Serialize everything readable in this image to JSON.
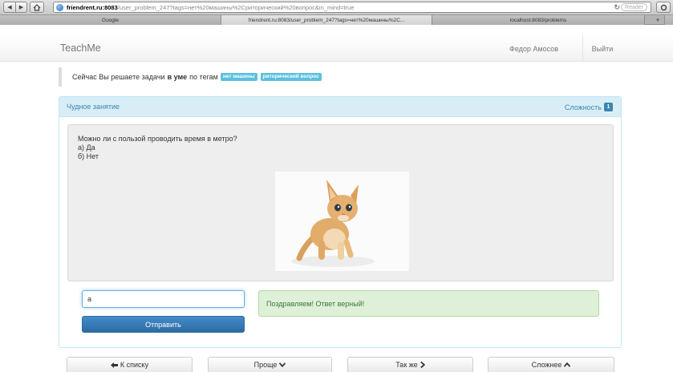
{
  "browser": {
    "url_host": "friendrent.ru:8083",
    "url_path": "/user_problem_247?tags=нет%20машины%2Cриторический%20вопрос&in_mind=true",
    "reader_label": "Reader",
    "tabs": [
      {
        "label": "Google",
        "active": false
      },
      {
        "label": "friendrent.ru:8083/user_problem_247?tags=нет%20машины%2C...",
        "active": true
      },
      {
        "label": "localhost:8083/problems",
        "active": false
      }
    ]
  },
  "navbar": {
    "brand": "TeachMe",
    "user_name": "Федор Амосов",
    "logout_label": "Выйти"
  },
  "info": {
    "prefix": "Сейчас Вы решаете задачи",
    "mode": "в уме",
    "tags_label": "по тегам",
    "tags": [
      "нет машины",
      "риторический вопрос"
    ]
  },
  "panel": {
    "title": "Чудное занятие",
    "difficulty_label": "Сложность",
    "difficulty_value": "1"
  },
  "question": {
    "text": "Можно ли с пользой проводить время в метро?",
    "options": [
      "а) Да",
      "б) Нет"
    ],
    "image_icon": "kitten-photo"
  },
  "answer": {
    "value": "a",
    "submit_label": "Отправить",
    "result_message": "Поздравляем! Ответ верный!"
  },
  "bottom_nav": {
    "back": "К списку",
    "easier": "Проще",
    "same": "Так же",
    "harder": "Сложнее"
  },
  "colors": {
    "accent": "#428bca",
    "info_text": "#3a87ad",
    "tag_bg": "#5bc0de",
    "success_bg": "#dff0d8",
    "success_text": "#3c763d"
  }
}
